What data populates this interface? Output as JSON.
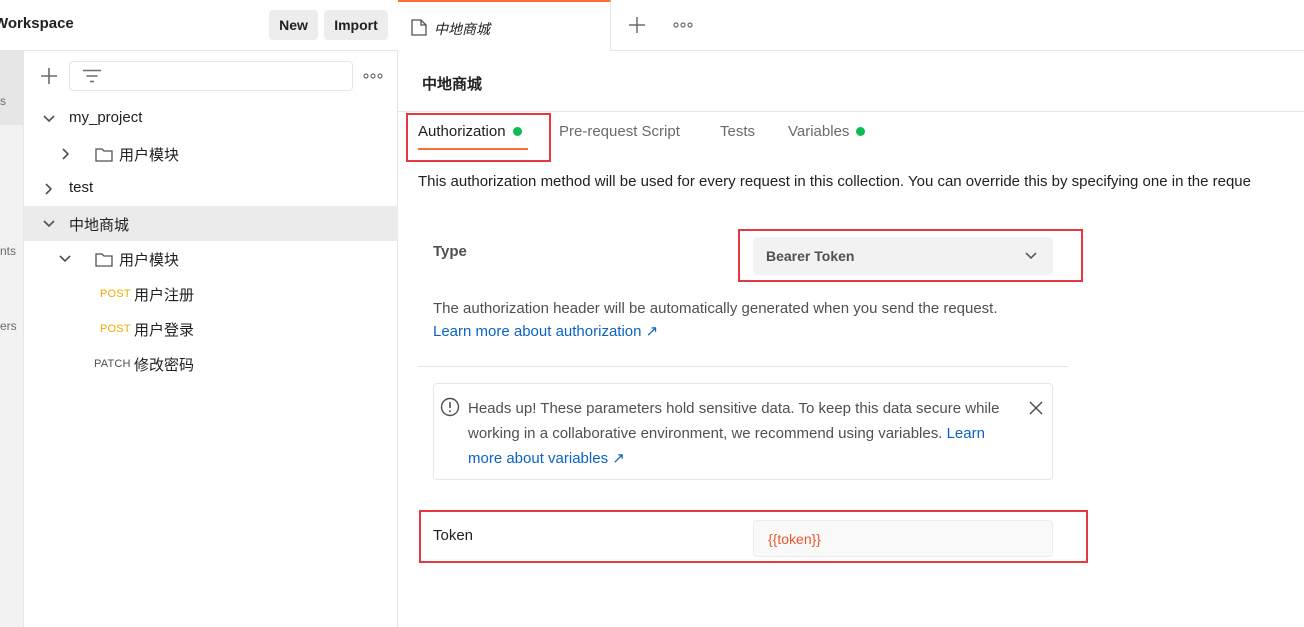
{
  "workspace": {
    "title": "Workspace",
    "new_label": "New",
    "import_label": "Import"
  },
  "rail": {
    "labels": [
      "s",
      "nts",
      "ers"
    ]
  },
  "sidebar": {
    "tree": [
      {
        "label": "my_project",
        "expanded": true
      },
      {
        "label": "用户模块",
        "expanded": false,
        "type": "folder"
      },
      {
        "label": "test",
        "expanded": false
      },
      {
        "label": "中地商城",
        "expanded": true,
        "selected": true
      },
      {
        "label": "用户模块",
        "expanded": true,
        "type": "folder"
      },
      {
        "method": "POST",
        "label": "用户注册"
      },
      {
        "method": "POST",
        "label": "用户登录"
      },
      {
        "method": "PATCH",
        "label": "修改密码"
      }
    ]
  },
  "tabbar": {
    "active_tab_label": "中地商城"
  },
  "main": {
    "collection_title": "中地商城",
    "subtabs": [
      "Authorization",
      "Pre-request Script",
      "Tests",
      "Variables"
    ],
    "description": "This authorization method will be used for every request in this collection. You can override this by specifying one in the reque",
    "type_label": "Type",
    "type_value": "Bearer Token",
    "help_text": "The authorization header will be automatically generated when you send the request.",
    "help_link": "Learn more about authorization ↗",
    "alert_text": "Heads up! These parameters hold sensitive data. To keep this data secure while working in a collaborative environment, we recommend using variables.",
    "alert_link": "Learn more about variables ↗",
    "token_label": "Token",
    "token_value": "{{token}}"
  },
  "colors": {
    "accent": "#ff6c37",
    "highlight_box": "#e2383e",
    "status_dot": "#0cbb52",
    "post_method": "#f2a900",
    "link": "#0b63c5",
    "token_variable": "#e8572b"
  }
}
